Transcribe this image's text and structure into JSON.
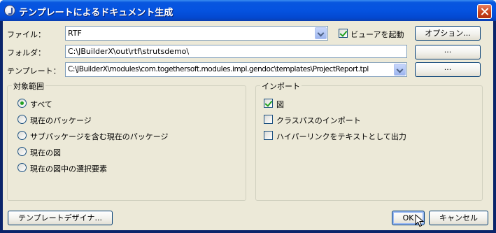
{
  "window": {
    "title": "テンプレートによるドキュメント生成",
    "accent": "#0553e0"
  },
  "fields": {
    "file_label": "ファイル：",
    "file_value": "RTF",
    "folder_label": "フォルダ：",
    "folder_value": "C:\\JBuilderX\\out\\rtf\\strutsdemo\\",
    "template_label": "テンプレート：",
    "template_value": "C:\\JBuilderX\\modules\\com.togethersoft.modules.impl.gendoc\\templates\\ProjectReport.tpl"
  },
  "viewer_checkbox": {
    "label": "ビューアを起動",
    "checked": true
  },
  "buttons": {
    "options": "オプション...",
    "browse_folder": "...",
    "browse_template": "...",
    "template_designer": "テンプレートデザイナ...",
    "ok": "OK",
    "cancel": "キャンセル"
  },
  "scope": {
    "title": "対象範囲",
    "options": [
      "すべて",
      "現在のパッケージ",
      "サブパッケージを含む現在のパッケージ",
      "現在の図",
      "現在の図中の選択要素"
    ],
    "selected": 0
  },
  "import": {
    "title": "インポート",
    "options": [
      {
        "label": "図",
        "checked": true
      },
      {
        "label": "クラスパスのインポート",
        "checked": false
      },
      {
        "label": "ハイパーリンクをテキストとして出力",
        "checked": false
      }
    ]
  },
  "icons": {
    "app": "app-icon",
    "close": "close-icon",
    "cursor": "mouse-pointer-icon"
  }
}
